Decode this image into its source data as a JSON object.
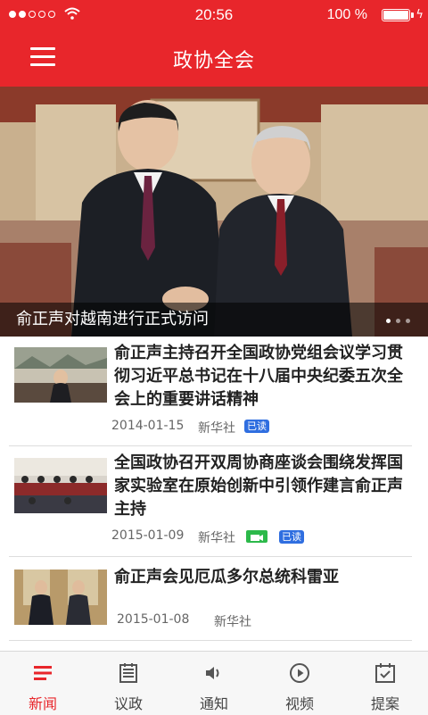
{
  "status_bar": {
    "time": "20:56",
    "battery": "100 %"
  },
  "header": {
    "title": "政协全会"
  },
  "banner": {
    "caption": "俞正声对越南进行正式访问",
    "pages": 3,
    "active_page": 1
  },
  "news": [
    {
      "headline": "俞正声主持召开全国政协党组会议学习贯彻习近平总书记在十八届中央纪委五次全会上的重要讲话精神",
      "date": "2014-01-15",
      "source": "新华社",
      "read_badge": "已读",
      "video": false
    },
    {
      "headline": "全国政协召开双周协商座谈会围绕发挥国家实验室在原始创新中引领作建言俞正声主持",
      "date": "2015-01-09",
      "source": "新华社",
      "read_badge": "已读",
      "video": true
    },
    {
      "headline": "俞正声会见厄瓜多尔总统科雷亚",
      "date": "2015-01-08",
      "source": "新华社",
      "read_badge": "",
      "video": false
    }
  ],
  "tabs": [
    {
      "label": "新闻",
      "icon": "news-icon",
      "active": true
    },
    {
      "label": "议政",
      "icon": "document-icon",
      "active": false
    },
    {
      "label": "通知",
      "icon": "speaker-icon",
      "active": false
    },
    {
      "label": "视频",
      "icon": "play-icon",
      "active": false
    },
    {
      "label": "提案",
      "icon": "proposal-icon",
      "active": false
    }
  ],
  "colors": {
    "brand": "#e8262b",
    "read_badge": "#2f6ee0",
    "video_badge": "#2cb94a"
  }
}
